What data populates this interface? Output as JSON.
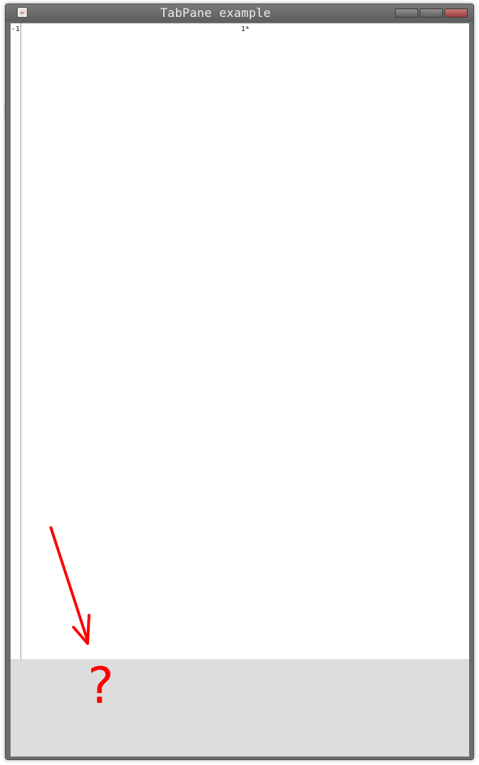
{
  "window": {
    "title": "TabPane example",
    "icon": "java-cup-icon"
  },
  "titlebar_buttons": [
    "minimize",
    "maximize",
    "close"
  ],
  "tab_pane": {
    "gutter_label": "-1",
    "tab_marker": "1*"
  },
  "annotation": {
    "text": "?",
    "color": "#ff0000"
  },
  "colors": {
    "frame": "#6c6c6c",
    "panel": "#dddddd",
    "close_button": "#b05050"
  }
}
